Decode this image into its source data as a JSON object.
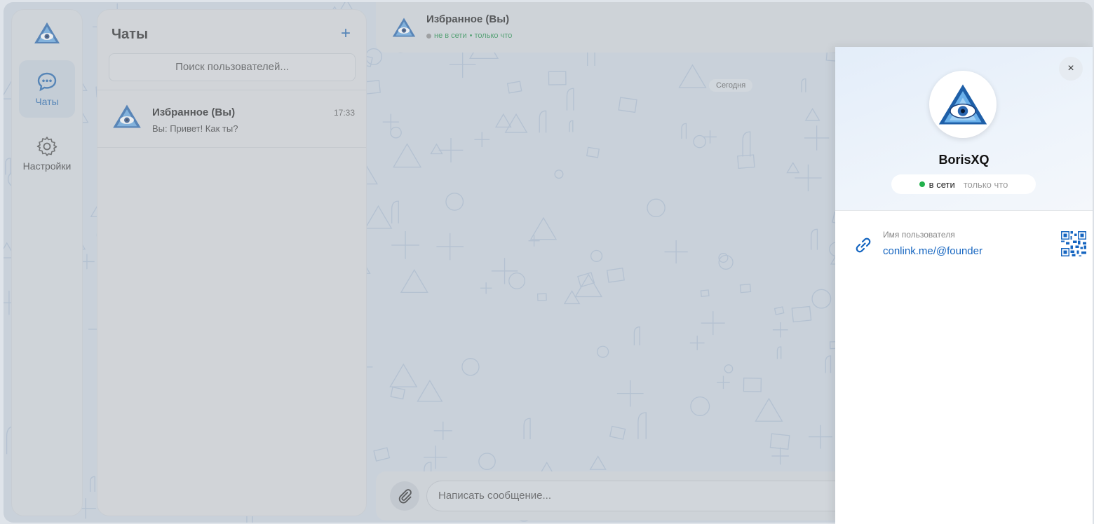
{
  "colors": {
    "accent": "#1a5fa8",
    "online": "#22b14c",
    "link": "#1565c0"
  },
  "rail": {
    "items": [
      {
        "label": "Чаты",
        "icon": "chat-bubble-icon",
        "active": true
      },
      {
        "label": "Настройки",
        "icon": "gear-icon",
        "active": false
      }
    ]
  },
  "chats": {
    "title": "Чаты",
    "add_label": "+",
    "search_placeholder": "Поиск пользователей...",
    "list": [
      {
        "name": "Избранное (Вы)",
        "preview": "Вы: Привет! Как ты?",
        "time": "17:33"
      }
    ]
  },
  "conversation": {
    "title": "Избранное (Вы)",
    "status": "не в сети",
    "last_seen": "• только что",
    "date_chip": "Сегодня",
    "input_placeholder": "Написать сообщение..."
  },
  "profile": {
    "close_label": "×",
    "name": "BorisXQ",
    "status_online": "в сети",
    "status_seen": "только что",
    "username_label": "Имя пользователя",
    "username_value": "conlink.me/@founder"
  }
}
